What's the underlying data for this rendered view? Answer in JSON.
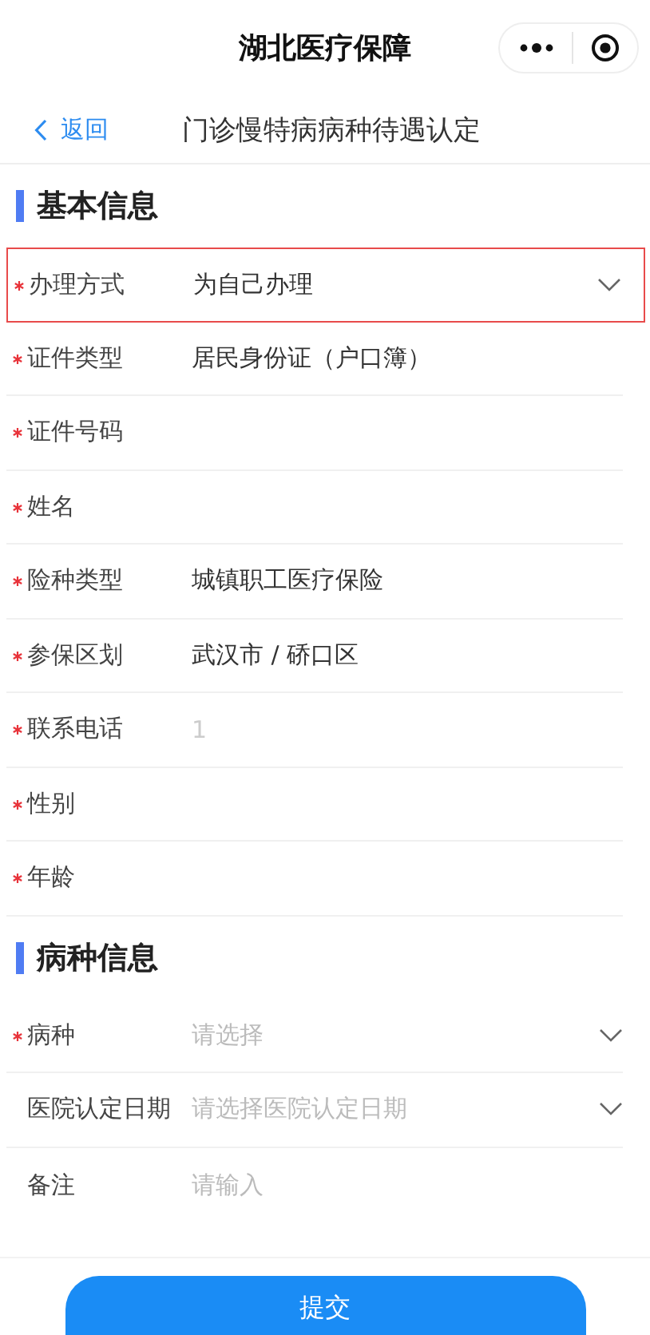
{
  "app_title": "湖北医疗保障",
  "nav": {
    "back": "返回",
    "title": "门诊慢特病病种待遇认定"
  },
  "sections": [
    {
      "title": "基本信息",
      "fields": [
        {
          "label": "办理方式",
          "required": true,
          "kind": "select",
          "value": "为自己办理",
          "highlighted": true
        },
        {
          "label": "证件类型",
          "required": true,
          "kind": "text",
          "value": "居民身份证（户口簿）",
          "highlighted": false
        },
        {
          "label": "证件号码",
          "required": true,
          "kind": "text",
          "highlighted": false
        },
        {
          "label": "姓名",
          "required": true,
          "kind": "text",
          "highlighted": false
        },
        {
          "label": "险种类型",
          "required": true,
          "kind": "text",
          "value": "城镇职工医疗保险",
          "highlighted": false
        },
        {
          "label": "参保区划",
          "required": true,
          "kind": "text",
          "value": "武汉市 / 硚口区",
          "highlighted": false
        },
        {
          "label": "联系电话",
          "required": true,
          "kind": "input",
          "value": "1",
          "highlighted": false
        },
        {
          "label": "性别",
          "required": true,
          "kind": "text",
          "highlighted": false
        },
        {
          "label": "年龄",
          "required": true,
          "kind": "text",
          "highlighted": false
        }
      ]
    },
    {
      "title": "病种信息",
      "fields": [
        {
          "label": "病种",
          "required": true,
          "kind": "select",
          "placeholder": "请选择",
          "highlighted": false
        },
        {
          "label": "医院认定日期",
          "required": false,
          "kind": "select",
          "placeholder": "请选择医院认定日期",
          "highlighted": false
        },
        {
          "label": "备注",
          "required": false,
          "kind": "textarea",
          "placeholder": "请输入",
          "highlighted": false
        }
      ]
    }
  ],
  "submit": "提交"
}
